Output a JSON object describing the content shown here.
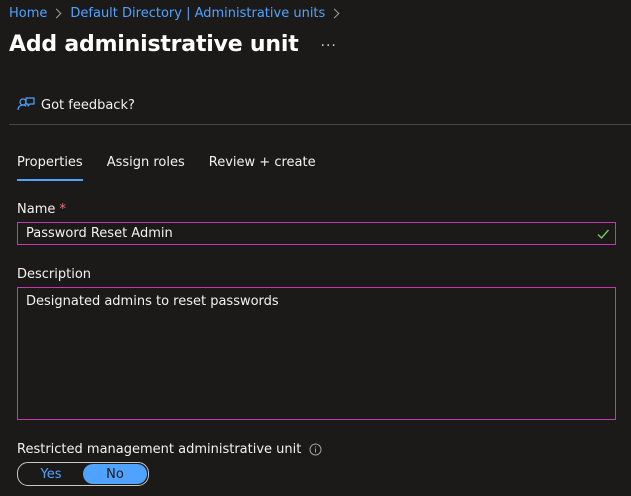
{
  "breadcrumb": {
    "items": [
      "Home",
      "Default Directory | Administrative units"
    ]
  },
  "header": {
    "title": "Add administrative unit",
    "more_label": "···"
  },
  "feedback": {
    "label": "Got feedback?"
  },
  "tabs": [
    {
      "label": "Properties",
      "active": true
    },
    {
      "label": "Assign roles",
      "active": false
    },
    {
      "label": "Review + create",
      "active": false
    }
  ],
  "form": {
    "name": {
      "label": "Name",
      "required_mark": "*",
      "value": "Password Reset Admin"
    },
    "description": {
      "label": "Description",
      "value": "Designated admins to reset passwords"
    },
    "restricted": {
      "label": "Restricted management administrative unit",
      "options": [
        "Yes",
        "No"
      ],
      "selected": "No"
    }
  },
  "colors": {
    "accent": "#4fa3ff",
    "focus_border": "#c239b3",
    "valid_check": "#6ccb5f",
    "required": "#f1707b",
    "background": "#1b1a19"
  }
}
